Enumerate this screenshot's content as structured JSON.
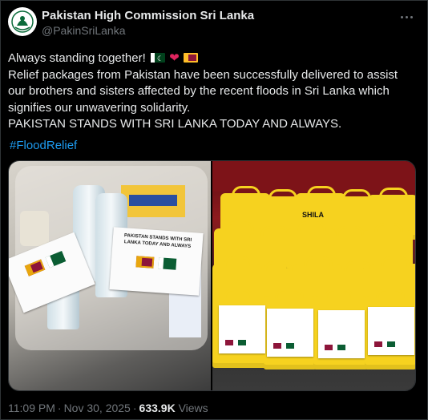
{
  "author": {
    "name": "Pakistan High Commission Sri Lanka",
    "handle": "@PakinSriLanka",
    "avatar_icon": "emblem-icon"
  },
  "tweet": {
    "line1": "Always standing together!",
    "line2": "Relief packages from Pakistan have been successfully delivered to assist",
    "line3": "our brothers and sisters affected by the recent floods in Sri Lanka which",
    "line4": "signifies our unwavering solidarity.",
    "line5": "PAKISTAN STANDS WITH SRI LANKA TODAY AND ALWAYS.",
    "hashtag": "#FloodRelief",
    "emojis": [
      "pakistan-flag",
      "red-heart",
      "sri-lanka-flag"
    ]
  },
  "media": {
    "photos": [
      {
        "alt": "relief package contents",
        "sign_text": "PAKISTAN STANDS WITH SRI LANKA TODAY AND ALWAYS"
      },
      {
        "alt": "yellow relief bags",
        "bag_brand": "SHILA"
      }
    ]
  },
  "footer": {
    "time": "11:09 PM",
    "date": "Nov 30, 2025",
    "views_count": "633.9K",
    "views_label": "Views"
  },
  "colors": {
    "background": "#000000",
    "text": "#e7e9ea",
    "secondary": "#71767b",
    "link": "#1d9bf0",
    "border": "#2f3336"
  }
}
